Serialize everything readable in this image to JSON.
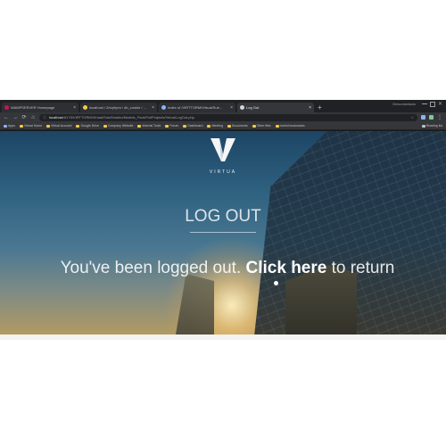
{
  "browser": {
    "tabs": [
      {
        "label": "WAMPSERVER Homepage",
        "color": "#c2185b"
      },
      {
        "label": "localhost / 2rs/phpm / db_cookie / ...",
        "color": "#f2c94c"
      },
      {
        "label": "Index of /VIRTTORM/Virtual/Sub...",
        "color": "#8ab4f8"
      },
      {
        "label": "Log Out",
        "color": "#cfd8dc"
      }
    ],
    "new_tab": "+",
    "profile": "Desconectado",
    "back": "←",
    "forward": "→",
    "reload": "⟳",
    "home": "⌂",
    "url_host": "localhost",
    "url_path": ":8175/VIRTTORM/Virtual/Sub/Modelo/Models_Final/FullProjects/Virtua/LogOut.php",
    "bookmarks": [
      "Apps",
      "Virtual Home",
      "Virtual Account",
      "Google Drive",
      "Company Website",
      "Internal Tools",
      "Forum",
      "Dashboard",
      "Meeting",
      "Documents",
      "Other files",
      "Useful bookmarks"
    ],
    "reading_list": "Reading list"
  },
  "page": {
    "brand": "VIRTUA",
    "heading": "LOG OUT",
    "message_before": "You've been logged out. ",
    "link_text": "Click here",
    "message_after": " to return"
  }
}
